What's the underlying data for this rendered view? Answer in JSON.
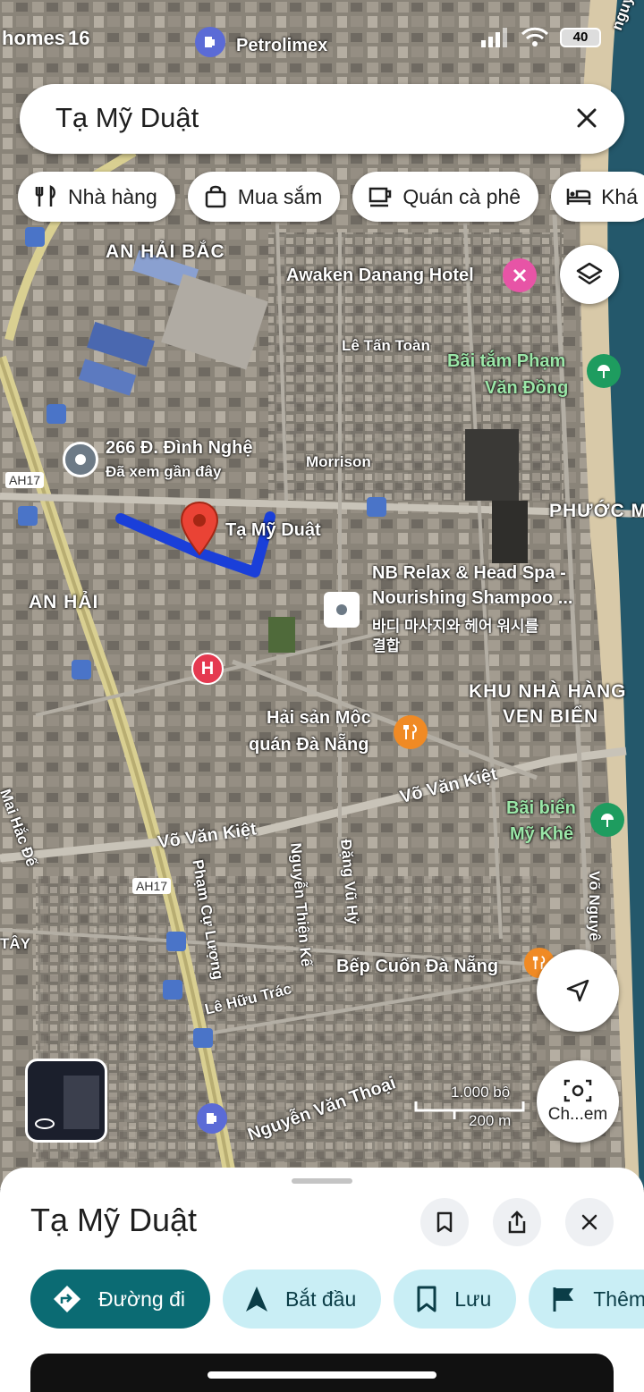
{
  "status_bar": {
    "left_text": "homes",
    "time": "16",
    "battery": "40"
  },
  "search": {
    "query": "Tạ Mỹ Duật"
  },
  "chips": [
    {
      "label": "Nhà hàng",
      "icon": "restaurant-icon"
    },
    {
      "label": "Mua sắm",
      "icon": "shopping-bag-icon"
    },
    {
      "label": "Quán cà phê",
      "icon": "coffee-icon"
    },
    {
      "label": "Khá",
      "icon": "hotel-icon"
    }
  ],
  "map": {
    "labels": {
      "petrolimex": "Petrolimex",
      "an_hai_bac": "AN HẢI BẮC",
      "awaken": "Awaken Danang Hotel",
      "le_tan_toan": "Lê Tấn Toàn",
      "bai_tam_line1": "Bãi tắm Phạm",
      "bai_tam_line2": "Văn Đồng",
      "dinh_nghe": "266 Đ. Đình Nghệ",
      "dinh_nghe_sub": "Đã xem gần đây",
      "morrison": "Morrison",
      "ah17_top": "AH17",
      "ah17_bottom": "AH17",
      "phuoc_my": "PHƯỚC MỸ",
      "selected": "Tạ Mỹ Duật",
      "an_hai": "AN HẢI",
      "nb_line1": "NB Relax & Head Spa -",
      "nb_line2": "Nourishing Shampoo ...",
      "nb_line3": "바디 마사지와 헤어 워시를",
      "nb_line4": "결합",
      "khu_nha_hang_line1": "KHU NHÀ HÀNG",
      "khu_nha_hang_line2": "VEN BIỂN",
      "hai_san_line1": "Hải sản Mộc",
      "hai_san_line2": "quán Đà Nẵng",
      "vo_van_kiet_right": "Võ Văn Kiệt",
      "vo_van_kiet_left": "Võ Văn Kiệt",
      "mai_hac_de": "Mai Hắc Đế",
      "bai_bien_line1": "Bãi biển",
      "bai_bien_line2": "Mỹ Khê",
      "pham_cu_luong": "Phạm Cự Lượng",
      "nguyen_thien_ke": "Nguyễn Thiện Kế",
      "dang_vu_hy": "Đặng Vũ Hỷ",
      "vo_nguyen": "Võ Nguyê",
      "tay": "TÂY",
      "bep_cuon": "Bếp Cuốn Đà Nẵng",
      "le_huu_trac": "Lê Hữu Trác",
      "nguyen_van_thoai": "Nguyễn Văn Thoại",
      "scale_ft": "1.000 bộ",
      "scale_m": "200 m",
      "nguyen_top": "nguyễn",
      "lens_label": "Ch...em"
    }
  },
  "sheet": {
    "title": "Tạ Mỹ Duật",
    "actions": [
      {
        "label": "Đường đi",
        "icon": "directions-icon"
      },
      {
        "label": "Bắt đầu",
        "icon": "navigation-arrow-icon"
      },
      {
        "label": "Lưu",
        "icon": "bookmark-icon"
      },
      {
        "label": "Thêm",
        "icon": "flag-icon"
      }
    ]
  },
  "colors": {
    "accent": "#0b6b73",
    "tonal": "#c9eef5",
    "route": "#1a3fd9",
    "pin_red": "#ea4335"
  }
}
